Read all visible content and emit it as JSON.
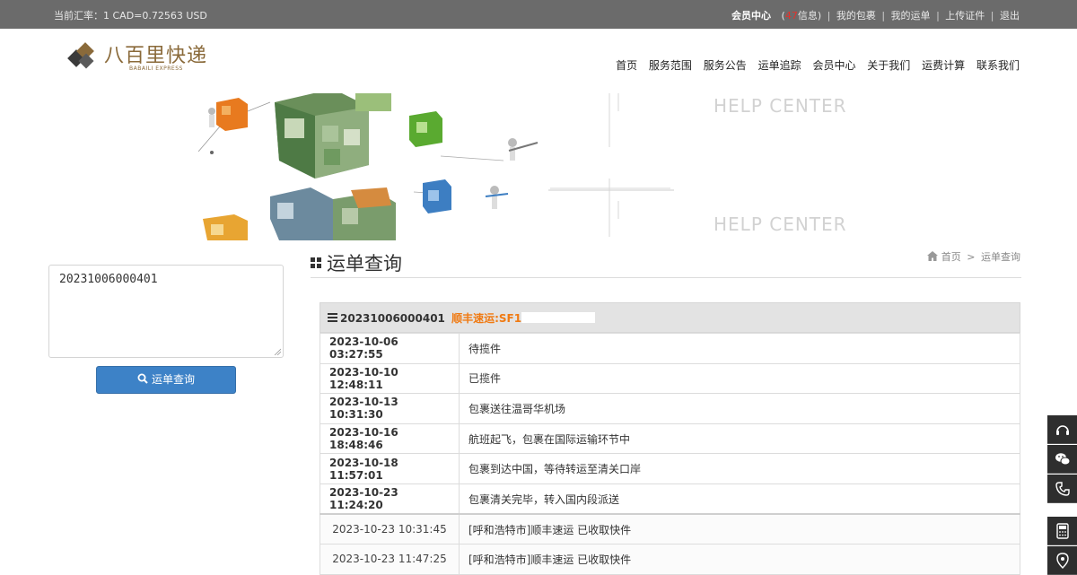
{
  "topbar": {
    "rate": "当前汇率：1 CAD=0.72563 USD",
    "member_center": "会员中心",
    "open_paren": "(",
    "msg_count": "47",
    "msg_label": "信息)",
    "my_packages": "我的包裹",
    "my_waybills": "我的运单",
    "upload_id": "上传证件",
    "logout": "退出",
    "sep": "|"
  },
  "logo": {
    "name": "八百里快递",
    "sub": "BABAILI EXPRESS"
  },
  "nav": [
    "首页",
    "服务范围",
    "服务公告",
    "运单追踪",
    "会员中心",
    "关于我们",
    "运费计算",
    "联系我们"
  ],
  "banner": {
    "help_top": "HELP CENTER",
    "help_bottom": "HELP CENTER"
  },
  "search": {
    "value": "20231006000401",
    "button_label": "运单查询"
  },
  "page": {
    "title": "运单查询",
    "breadcrumb_home": "首页",
    "breadcrumb_sep": ">",
    "breadcrumb_current": "运单查询"
  },
  "tracking": {
    "number": "20231006000401",
    "carrier": "顺丰速运:SF",
    "carrier_partial": "1",
    "events": [
      {
        "time": "2023-10-06 03:27:55",
        "desc": "待揽件",
        "domestic": false
      },
      {
        "time": "2023-10-10 12:48:11",
        "desc": "已揽件",
        "domestic": false
      },
      {
        "time": "2023-10-13 10:31:30",
        "desc": "包裹送往温哥华机场",
        "domestic": false
      },
      {
        "time": "2023-10-16 18:48:46",
        "desc": "航班起飞，包裹在国际运输环节中",
        "domestic": false
      },
      {
        "time": "2023-10-18 11:57:01",
        "desc": "包裹到达中国，等待转运至清关口岸",
        "domestic": false
      },
      {
        "time": "2023-10-23 11:24:20",
        "desc": "包裹清关完毕，转入国内段派送",
        "domestic": false
      },
      {
        "time": "2023-10-23 10:31:45",
        "desc": "[呼和浩特市]顺丰速运 已收取快件",
        "domestic": true
      },
      {
        "time": "2023-10-23 11:47:25",
        "desc": "[呼和浩特市]顺丰速运 已收取快件",
        "domestic": true
      }
    ]
  },
  "float_bar": {
    "icons": [
      "headset-icon",
      "wechat-icon",
      "phone-icon",
      "calculator-icon",
      "location-icon"
    ]
  },
  "colors": {
    "topbar": "#6b6b6b",
    "button": "#3d82c7",
    "carrier": "#f07a12",
    "logo": "#8a6a3a",
    "alert": "#e2322d"
  }
}
